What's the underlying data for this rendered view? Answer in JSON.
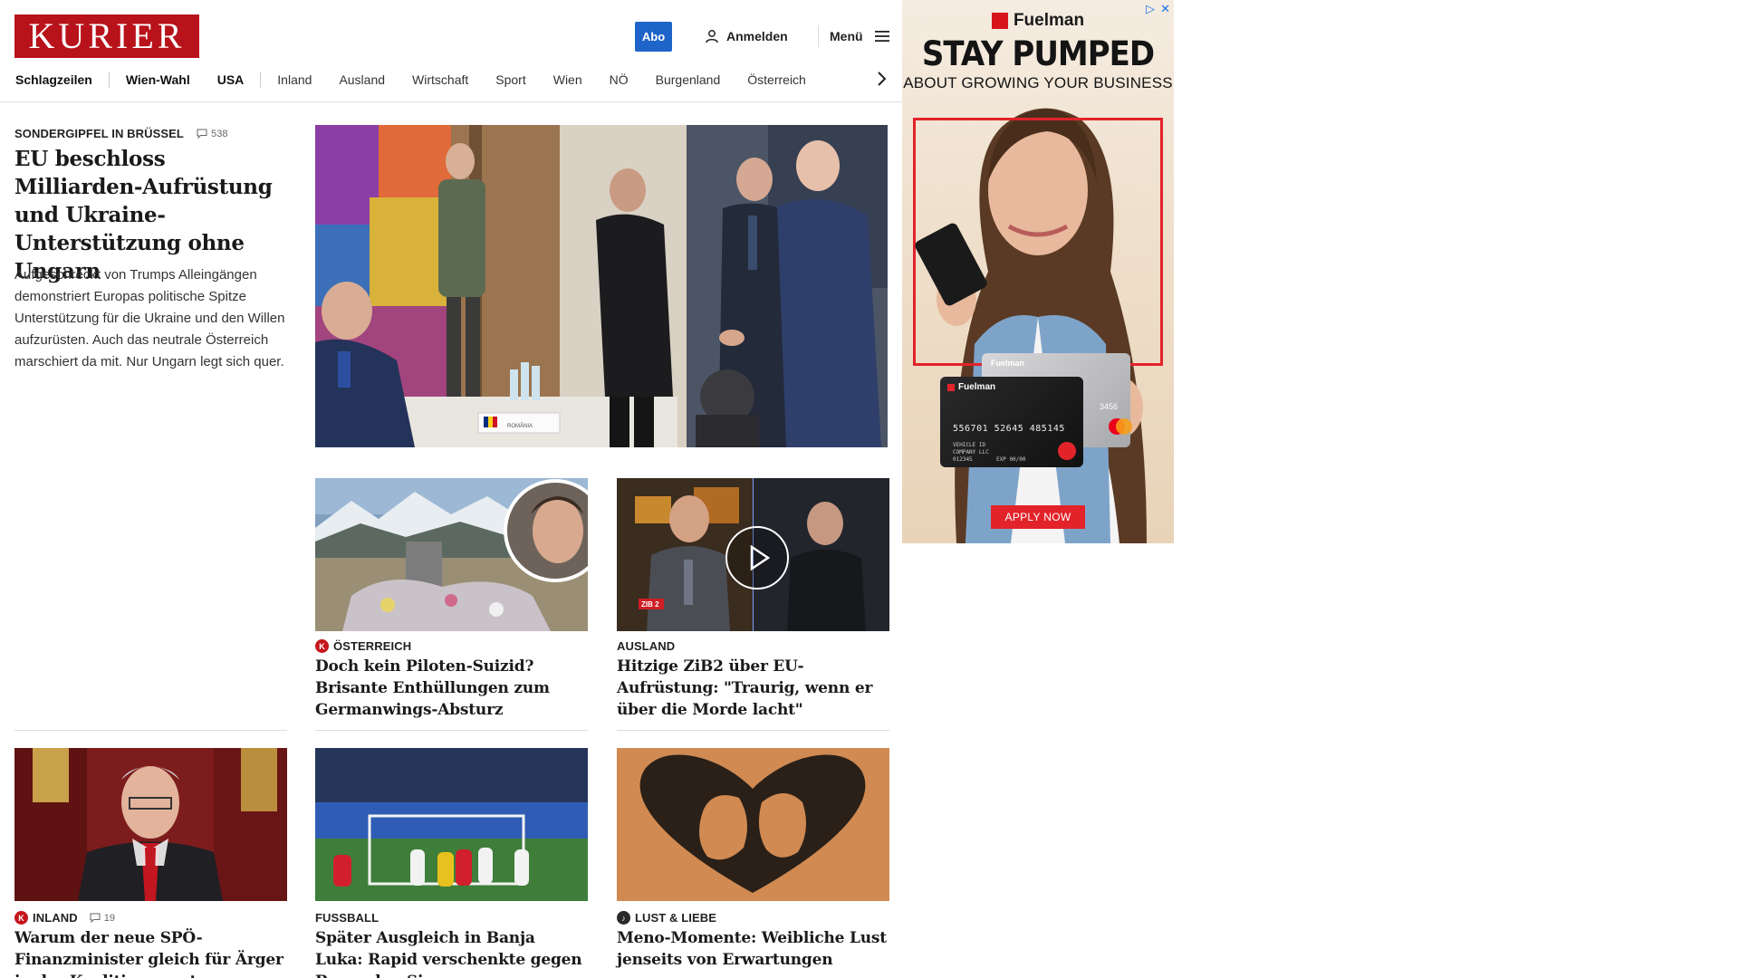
{
  "header": {
    "logo": "KURIER",
    "abo": "Abo",
    "login": "Anmelden",
    "menu": "Menü"
  },
  "nav": [
    "Schlagzeilen",
    "Wien-Wahl",
    "USA",
    "Inland",
    "Ausland",
    "Wirtschaft",
    "Sport",
    "Wien",
    "NÖ",
    "Burgenland",
    "Österreich"
  ],
  "lead": {
    "kicker": "Sondergipfel in Brüssel",
    "comments": "538",
    "title": "EU beschloss Milliarden-Aufrüstung und Ukraine-Unterstützung ohne Ungarn",
    "teaser": "Aufgeschreckt von Trumps Alleingängen demonstriert Europas politische Spitze Unterstützung für die Ukraine und den Willen aufzurüsten. Auch das neutrale Österreich marschiert da mit. Nur Ungarn legt sich quer.",
    "nameplate": "ROMÂNIA"
  },
  "cards": [
    {
      "kicker": "Österreich",
      "badge": "K",
      "title": "Doch kein Piloten-Suizid? Brisante Enthüllungen zum Germanwings-Absturz"
    },
    {
      "kicker": "Ausland",
      "title": "Hitzige ZiB2 über EU-Aufrüstung: \"Traurig, wenn er über die Morde lacht\"",
      "tv_logo": "ZIB 2"
    },
    {
      "kicker": "Inland",
      "badge": "K",
      "comments": "19",
      "title": "Warum der neue SPÖ-Finanzminister gleich für Ärger in der Koalition sorgt"
    },
    {
      "kicker": "Fussball",
      "title": "Später Ausgleich in Banja Luka: Rapid verschenkte gegen Borac den Sieg"
    },
    {
      "kicker": "Lust & Liebe",
      "badge": "♪",
      "title": "Meno-Momente: Weibliche Lust jenseits von Erwartungen"
    }
  ],
  "ad": {
    "brand": "Fuelman",
    "headline": "STAY PUMPED",
    "subline": "ABOUT GROWING YOUR BUSINESS",
    "card_brand": "Fuelman",
    "card_number": "556701 52645 485145",
    "card_small": "3456",
    "card_holder": "VEHICLE ID",
    "card_company": "COMPANY LLC",
    "card_id": "012345",
    "card_exp": "EXP 00/00",
    "cta": "APPLY NOW",
    "colors": {
      "brand_red": "#e2232a",
      "background": "#efe0cc"
    }
  },
  "colors": {
    "logo_red": "#b8121b",
    "abo_blue": "#1f64c8"
  }
}
